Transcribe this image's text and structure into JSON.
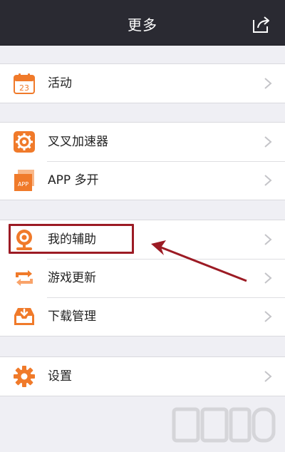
{
  "header": {
    "title": "更多",
    "share_icon": "share-icon"
  },
  "groups": [
    {
      "items": [
        {
          "label": "活动",
          "icon": "calendar-icon",
          "icon_text": "23"
        }
      ]
    },
    {
      "items": [
        {
          "label": "叉叉加速器",
          "icon": "gear-icon"
        },
        {
          "label": "APP 多开",
          "icon": "app-icon",
          "icon_text": "APP"
        }
      ]
    },
    {
      "items": [
        {
          "label": "我的辅助",
          "icon": "webcam-icon"
        },
        {
          "label": "游戏更新",
          "icon": "refresh-icon"
        },
        {
          "label": "下载管理",
          "icon": "download-tray-icon"
        }
      ]
    },
    {
      "items": [
        {
          "label": "设置",
          "icon": "settings-icon"
        }
      ]
    }
  ],
  "annotation": {
    "highlight_color": "#9c1b24",
    "arrow_color": "#9c1b24"
  },
  "colors": {
    "navbar": "#2a2a32",
    "background": "#efeff4",
    "icon_orange": "#f07a2a"
  }
}
